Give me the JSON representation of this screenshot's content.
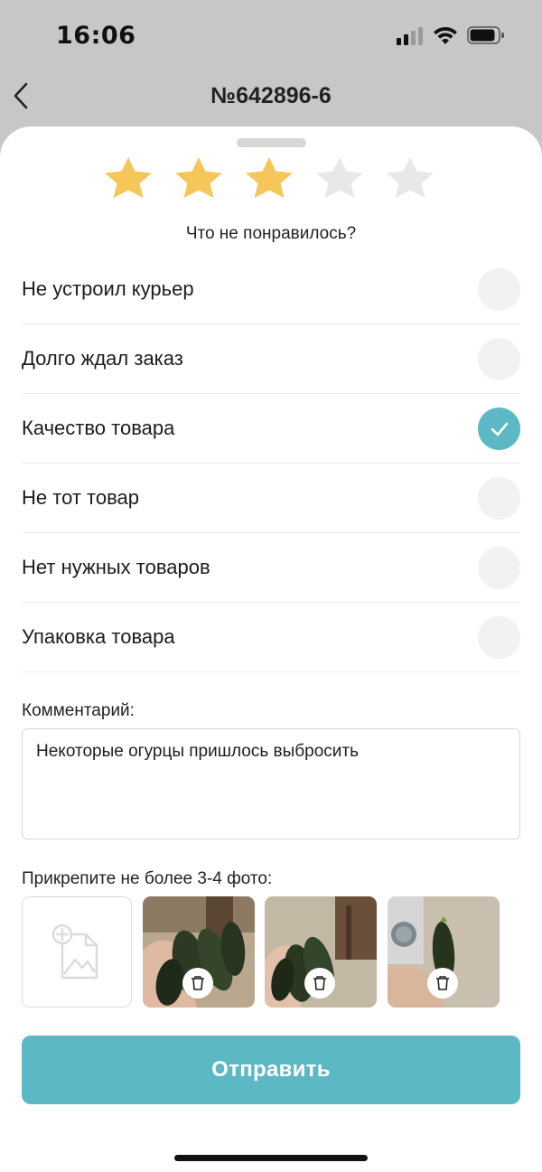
{
  "status_bar": {
    "time": "16:06"
  },
  "nav": {
    "title": "№642896-6",
    "back_icon": "chevron-left-icon"
  },
  "rating": {
    "value": 3,
    "max": 5,
    "filled_color": "#f5c65a",
    "empty_color": "#e8e8e8"
  },
  "question": "Что не понравилось?",
  "reasons": [
    {
      "label": "Не устроил курьер",
      "checked": false
    },
    {
      "label": "Долго ждал заказ",
      "checked": false
    },
    {
      "label": "Качество товара",
      "checked": true
    },
    {
      "label": "Не тот товар",
      "checked": false
    },
    {
      "label": "Нет нужных товаров",
      "checked": false
    },
    {
      "label": "Упаковка товара",
      "checked": false
    }
  ],
  "comment": {
    "label": "Комментарий:",
    "value": "Некоторые огурцы пришлось выбросить"
  },
  "photos": {
    "label": "Прикрепите не более 3-4 фото:",
    "add_icon": "add-image-icon",
    "items": [
      {
        "subject": "cucumbers-in-hand",
        "delete_icon": "trash-icon"
      },
      {
        "subject": "cucumbers-in-hand",
        "delete_icon": "trash-icon"
      },
      {
        "subject": "cucumber-in-hand",
        "delete_icon": "trash-icon"
      }
    ]
  },
  "submit_label": "Отправить",
  "colors": {
    "accent": "#5bb8c4",
    "star": "#f5c65a",
    "backdrop": "#c7c7c7"
  }
}
